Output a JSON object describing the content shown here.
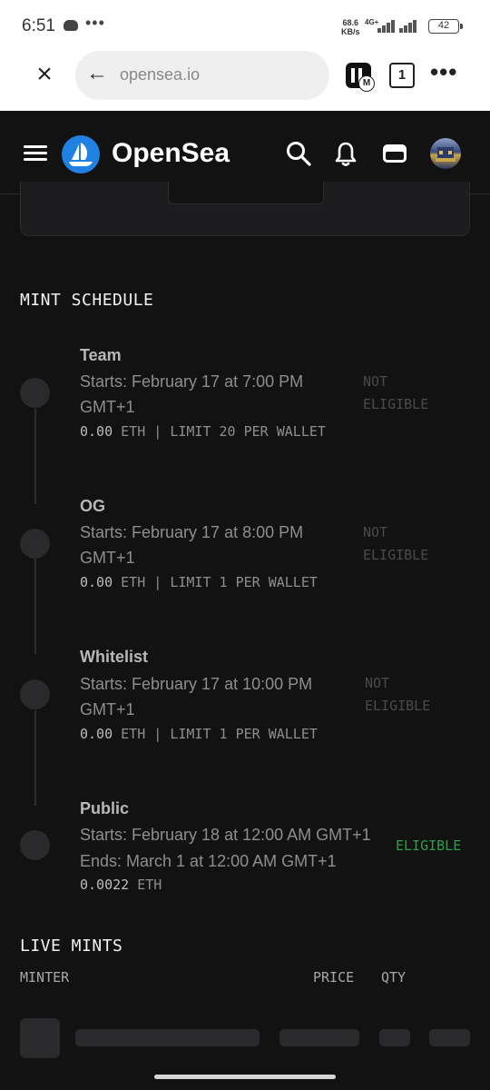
{
  "status_bar": {
    "time": "6:51",
    "dots": "•••",
    "speed_value": "68.6",
    "speed_unit": "KB/s",
    "network": "4G+",
    "battery": "42"
  },
  "browser": {
    "url": "opensea.io",
    "tab_count": "1",
    "extension_badge": "M",
    "more": "•••"
  },
  "header": {
    "brand": "OpenSea"
  },
  "mint_schedule": {
    "title": "MINT SCHEDULE",
    "phases": [
      {
        "name": "Team",
        "starts": "Starts: February 17 at 7:00 PM",
        "starts_tz": "GMT+1",
        "price_amount": "0.00",
        "price_detail": "ETH | LIMIT 20 PER WALLET",
        "status_line1": "NOT",
        "status_line2": "ELIGIBLE"
      },
      {
        "name": "OG",
        "starts": "Starts: February 17 at 8:00 PM",
        "starts_tz": "GMT+1",
        "price_amount": "0.00",
        "price_detail": "ETH | LIMIT 1 PER WALLET",
        "status_line1": "NOT",
        "status_line2": "ELIGIBLE"
      },
      {
        "name": "Whitelist",
        "starts": "Starts: February 17 at 10:00 PM",
        "starts_tz": "GMT+1",
        "price_amount": "0.00",
        "price_detail": "ETH | LIMIT 1 PER WALLET",
        "status_line1": "NOT",
        "status_line2": "ELIGIBLE"
      },
      {
        "name": "Public",
        "starts": "Starts: February 18 at 12:00 AM GMT+1",
        "ends": "Ends: March 1 at 12:00 AM GMT+1",
        "price_amount": "0.0022",
        "price_detail": "ETH",
        "status": "ELIGIBLE"
      }
    ]
  },
  "live_mints": {
    "title": "LIVE MINTS",
    "columns": [
      "MINTER",
      "PRICE",
      "QTY"
    ]
  },
  "colors": {
    "background": "#121212",
    "brand_blue": "#2081e2",
    "eligible_green": "#2e9d4b",
    "not_eligible_gray": "#4a4a4a"
  }
}
